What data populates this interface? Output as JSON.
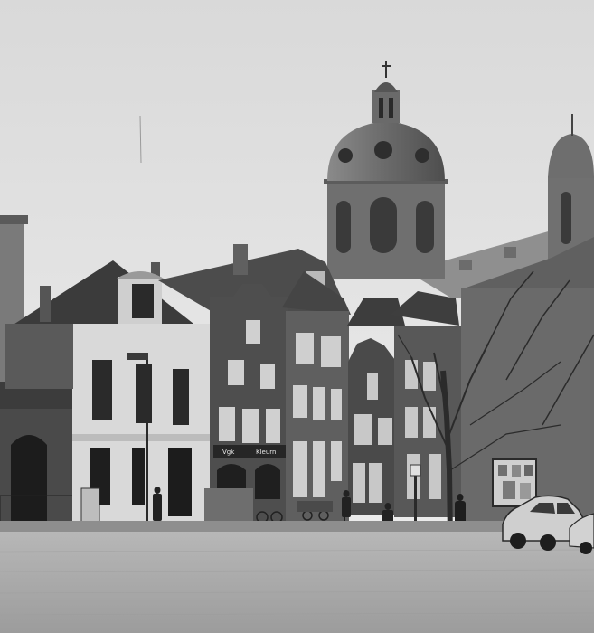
{
  "image": {
    "kind": "black-and-white photograph",
    "colors": {
      "sky": "#e9e9e9",
      "sky_top": "#dcdcdc",
      "road": "#a6a6a6",
      "road_light": "#bdbdbd",
      "roof_dark": "#3c3c3c",
      "roof_mid": "#5e5e5e",
      "dome": "#6a6a6a",
      "brick_dark": "#4a4a4a",
      "brick_mid": "#6d6d6d",
      "white_facade": "#dadada",
      "window": "#1e1e1e",
      "tree": "#2a2a2a"
    }
  },
  "shopfront": {
    "sign_left": "Vgk",
    "sign_right": "Kleurn"
  }
}
